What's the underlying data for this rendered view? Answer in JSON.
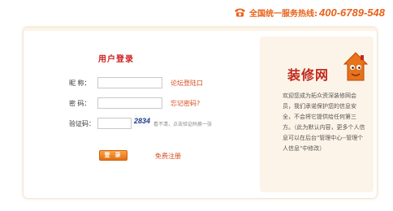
{
  "header": {
    "hotline_label": "全国统一服务热线:",
    "hotline_number": "400-6789-548",
    "phone_icon": "phone-icon"
  },
  "login": {
    "title": "用户登录",
    "username_label": "昵  称：",
    "username_value": "",
    "password_label": "密  码：",
    "password_value": "",
    "captcha_label": "验证码：",
    "captcha_value": "",
    "captcha_code": "2834",
    "captcha_hint": "看不清，点击验证码换一张",
    "forum_login_link": "论坛登陆口",
    "forgot_password_link": "忘记密码?",
    "login_button": "登 录",
    "register_link": "免费注册"
  },
  "brand": {
    "name": "装修网",
    "logo_icon": "house-mascot-icon",
    "intro": "欢迎您成为拓众资深装修网会员，我们承诺保护您的信息安全，不会将它提供给任何第三方。（此为默认内容，更多个人信息可以在后台\"管理中心--管理个人信息\"中修改）"
  },
  "colors": {
    "accent": "#e8621b",
    "title_red": "#cc1e1e",
    "link": "#d64a1c",
    "panel_bg": "#fcf4e8"
  }
}
